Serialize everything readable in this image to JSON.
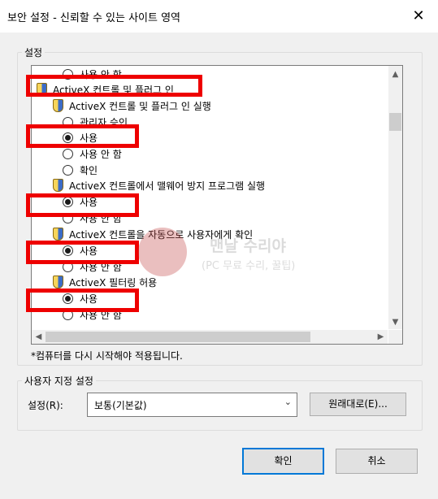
{
  "window": {
    "title": "보안 설정 - 신뢰할 수 있는 사이트 영역",
    "close_glyph": "✕"
  },
  "settings_group": {
    "label": "설정"
  },
  "settings_list": {
    "rows": [
      {
        "type": "option",
        "label": "사용 안 함",
        "selected": false
      },
      {
        "type": "category",
        "label": "ActiveX 컨트롤 및 플러그 인"
      },
      {
        "type": "setting",
        "label": "ActiveX 컨트롤 및 플러그 인 실행"
      },
      {
        "type": "option",
        "label": "관리자 승인",
        "selected": false
      },
      {
        "type": "option",
        "label": "사용",
        "selected": true
      },
      {
        "type": "option",
        "label": "사용 안 함",
        "selected": false
      },
      {
        "type": "option",
        "label": "확인",
        "selected": false
      },
      {
        "type": "setting",
        "label": "ActiveX 컨트롤에서 맬웨어 방지 프로그램 실행"
      },
      {
        "type": "option",
        "label": "사용",
        "selected": true
      },
      {
        "type": "option",
        "label": "사용 안 함",
        "selected": false
      },
      {
        "type": "setting",
        "label": "ActiveX 컨트롤을 자동으로 사용자에게 확인"
      },
      {
        "type": "option",
        "label": "사용",
        "selected": true
      },
      {
        "type": "option",
        "label": "사용 안 함",
        "selected": false
      },
      {
        "type": "setting",
        "label": "ActiveX 필터링 허용"
      },
      {
        "type": "option",
        "label": "사용",
        "selected": true
      },
      {
        "type": "option",
        "label": "사용 안 함",
        "selected": false
      }
    ],
    "scroll_up": "▲",
    "scroll_down": "▼",
    "scroll_left": "◀",
    "scroll_right": "▶"
  },
  "note": "*컴퓨터를 다시 시작해야 적용됩니다.",
  "custom_group": {
    "label": "사용자 지정 설정",
    "field_label": "설정(R):",
    "selected_value": "보통(기본값)",
    "dropdown_glyph": "⌄",
    "reset_button": "원래대로(E)..."
  },
  "buttons": {
    "ok": "확인",
    "cancel": "취소"
  },
  "watermark": {
    "title": "맨날 수리야",
    "subtitle": "(PC 무료 수리, 꿀팁)"
  },
  "colors": {
    "highlight": "#ee0000",
    "accent": "#0078d7"
  }
}
